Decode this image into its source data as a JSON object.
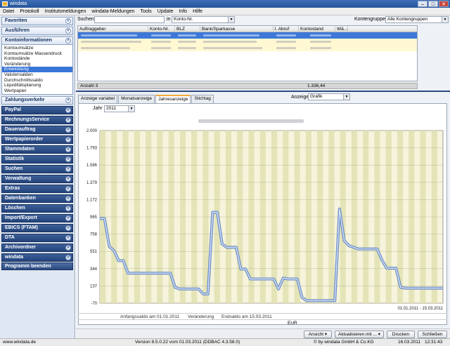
{
  "window": {
    "title": "windata"
  },
  "menu": [
    "Datei",
    "Protokoll",
    "Institutsmeldungen",
    "windata-Meldungen",
    "Tools",
    "Update",
    "Info",
    "Hilfe"
  ],
  "sidebar": {
    "favoriten": "Favoriten",
    "ausfuehren": "Ausführen",
    "kontoinformationen": "Kontoinformationen",
    "konto_items": [
      "Kontoumsätze",
      "Kontoumsätze Massendruck",
      "Kontostände",
      "Veränderung",
      "Entwicklung",
      "Valutensalden",
      "Durchschnittssaldo",
      "Liquiditätsplanung",
      "Wertpapier"
    ],
    "sections": [
      "Zahlungsverkehr",
      "PayPal",
      "RechnungsService",
      "Dauerauftrag",
      "Wertpapierorder",
      "Stammdaten",
      "Statistik",
      "Suchen",
      "Verwaltung",
      "Extras",
      "Datenbanken",
      "Löschen",
      "Import/Export",
      "EBICS (FTAM)",
      "DTA",
      "Archivordner",
      "windata"
    ],
    "quit": "Programm beenden"
  },
  "search": {
    "label": "Suchen",
    "in_label": "in",
    "field_value": "Konto-Nr.",
    "group_label": "Kontengruppe",
    "group_value": "Alle Kontengruppen"
  },
  "grid": {
    "columns": [
      "Auftraggeber",
      "Konto-Nr.",
      "BLZ",
      "Bank/Sparkasse",
      "l. Abruf",
      "Kontostand",
      "Wä..."
    ],
    "summary_label": "Anzahl 3",
    "summary_total": "1.336,44"
  },
  "tabs": [
    "Anzeige variabel",
    "Monatsanzeige",
    "Jahresanzeige",
    "Stichtag"
  ],
  "view": {
    "label": "Anzeige",
    "value": "Grafik",
    "year_label": "Jahr",
    "year_value": "2011"
  },
  "footer": {
    "anfang": "Anfangssaldo am 01.01.2011",
    "veraenderung": "Veränderung",
    "end": "Endsaldo am 15.03.2011",
    "currency": "EUR"
  },
  "buttons": {
    "ansicht": "Ansicht",
    "aktualisieren": "Aktualisieren mit ...",
    "drucken": "Drucken",
    "schliessen": "Schließen"
  },
  "status": {
    "url": "www.windata.de",
    "version": "Version 8.5.0.22 vom 01.03.2011 (DDBAC 4.3.58.0)",
    "copyright": "© by windata GmbH & Co.KG",
    "date": "16.03.2011",
    "time": "12:31:43"
  },
  "chart_data": {
    "type": "line",
    "range_label": "01.01.2011 - 15.03.2011",
    "ylim": [
      -70,
      2000
    ],
    "yticks": [
      "2.000",
      "1.793",
      "1.586",
      "1.379",
      "1.172",
      "965",
      "758",
      "551",
      "344",
      "137",
      "-70"
    ],
    "ytick_values": [
      2000,
      1793,
      1586,
      1379,
      1172,
      965,
      758,
      551,
      344,
      137,
      -70
    ],
    "x": [
      0,
      1,
      2,
      3,
      4,
      5,
      6,
      7,
      8,
      9,
      10,
      11,
      12,
      13,
      14,
      15,
      16,
      17,
      18,
      19,
      20,
      21,
      22,
      23,
      24,
      25,
      26,
      27,
      28,
      29,
      30,
      31,
      32,
      33,
      34,
      35,
      36,
      37,
      38,
      39,
      40,
      41,
      42,
      43,
      44,
      45,
      46,
      47,
      48,
      49,
      50,
      51,
      52,
      53,
      54,
      55,
      56,
      57,
      58,
      59,
      60,
      61,
      62,
      63,
      64,
      65,
      66,
      67,
      68,
      69,
      70,
      71,
      72,
      73
    ],
    "values": [
      945,
      945,
      610,
      560,
      440,
      440,
      290,
      290,
      290,
      290,
      290,
      290,
      290,
      290,
      290,
      290,
      120,
      100,
      100,
      100,
      100,
      100,
      40,
      40,
      1020,
      1020,
      640,
      600,
      600,
      600,
      340,
      340,
      220,
      220,
      220,
      220,
      220,
      220,
      100,
      230,
      220,
      220,
      220,
      0,
      -40,
      -40,
      -40,
      -40,
      -40,
      -40,
      -40,
      1060,
      680,
      620,
      600,
      580,
      580,
      580,
      580,
      580,
      450,
      350,
      350,
      350,
      120,
      110,
      110,
      110,
      110,
      110,
      110,
      110,
      110,
      110
    ],
    "grid": true
  }
}
